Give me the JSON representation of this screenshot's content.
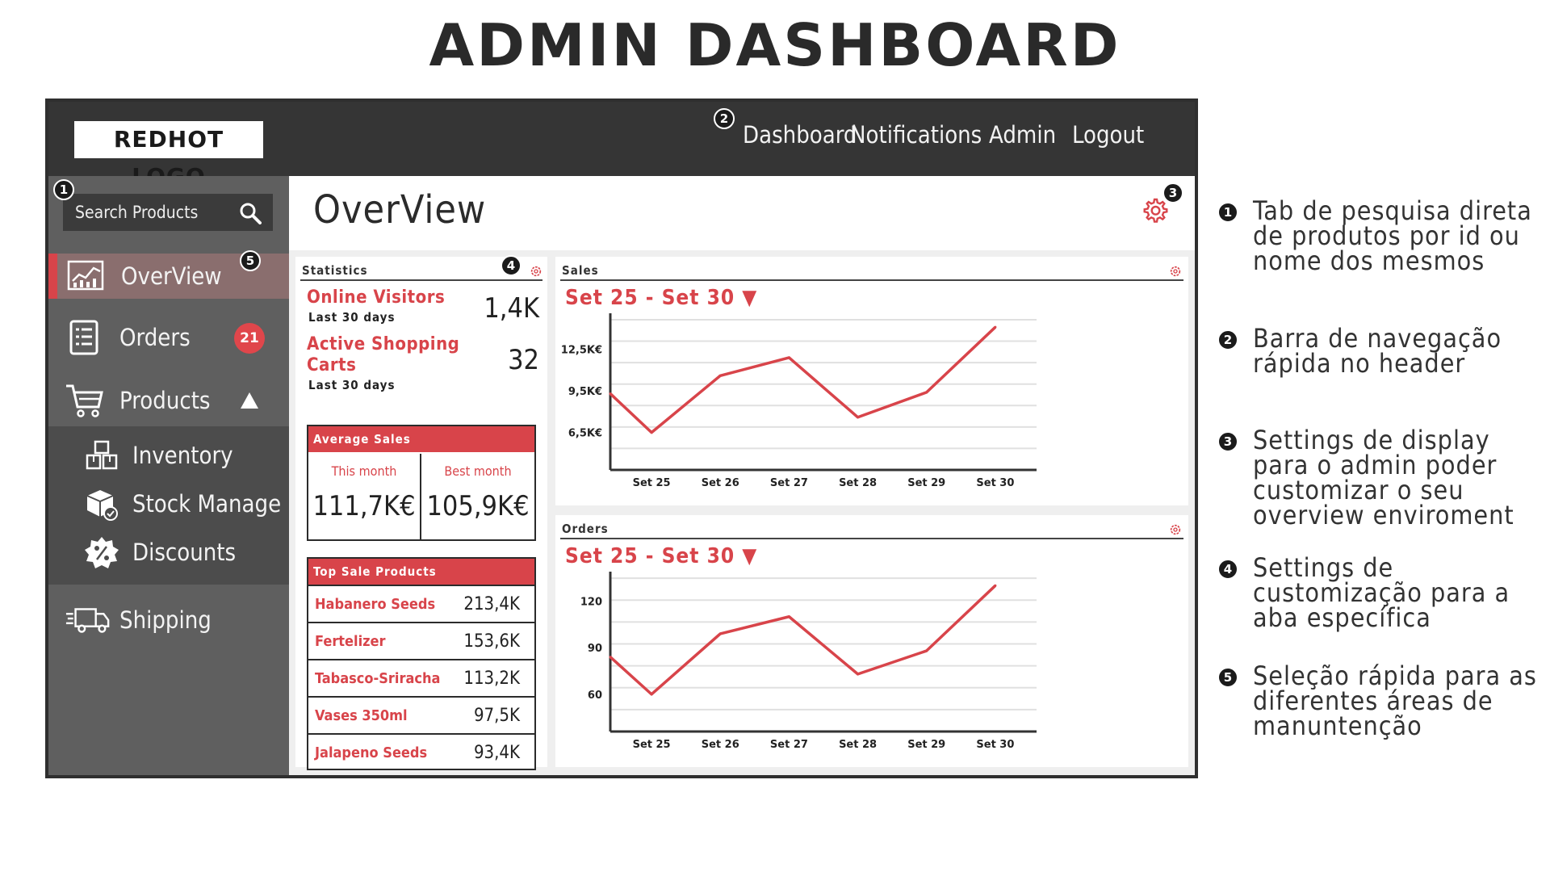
{
  "page": {
    "title": "ADMIN DASHBOARD"
  },
  "header": {
    "logo": "REDHOT LOGO",
    "nav": [
      "Dashboard",
      "Notifications",
      "Admin",
      "Logout"
    ]
  },
  "markers": [
    "1",
    "2",
    "3",
    "4",
    "5"
  ],
  "sidebar": {
    "search_placeholder": "Search Products",
    "items": [
      {
        "label": "OverView",
        "icon": "overview-icon"
      },
      {
        "label": "Orders",
        "icon": "orders-icon",
        "badge": "21"
      },
      {
        "label": "Products",
        "icon": "cart-icon"
      },
      {
        "label": "Shipping",
        "icon": "truck-icon"
      }
    ],
    "subitems": [
      {
        "label": "Inventory",
        "icon": "boxes-icon"
      },
      {
        "label": "Stock Manage",
        "icon": "stock-box-icon"
      },
      {
        "label": "Discounts",
        "icon": "discount-icon"
      }
    ]
  },
  "main": {
    "title": "OverView",
    "statistics": {
      "title": "Statistics",
      "items": [
        {
          "label": "Online Visitors",
          "sub": "Last 30 days",
          "value": "1,4K"
        },
        {
          "label": "Active Shopping Carts",
          "sub": "Last 30 days",
          "value": "32"
        }
      ],
      "avg_sales": {
        "title": "Average Sales",
        "cells": [
          {
            "label": "This month",
            "value": "111,7K€"
          },
          {
            "label": "Best month",
            "value": "105,9K€"
          }
        ]
      },
      "top_products": {
        "title": "Top Sale Products",
        "rows": [
          {
            "name": "Habanero Seeds",
            "value": "213,4K"
          },
          {
            "name": "Fertelizer",
            "value": "153,6K"
          },
          {
            "name": "Tabasco-Sriracha",
            "value": "113,2K"
          },
          {
            "name": "Vases 350ml",
            "value": "97,5K"
          },
          {
            "name": "Jalapeno Seeds",
            "value": "93,4K"
          }
        ]
      }
    },
    "sales": {
      "title": "Sales",
      "range": "Set 25 - Set 30 ▼"
    },
    "orders": {
      "title": "Orders",
      "range": "Set 25 - Set 30 ▼"
    }
  },
  "legend": [
    {
      "num": "1",
      "text": "Tab de pesquisa direta de produtos por id ou nome dos mesmos"
    },
    {
      "num": "2",
      "text": "Barra de navegação rápida no header"
    },
    {
      "num": "3",
      "text": "Settings de display para o admin poder customizar o seu overview enviroment"
    },
    {
      "num": "4",
      "text": "Settings de customização para a aba específica"
    },
    {
      "num": "5",
      "text": "Seleção rápida para as diferentes áreas de manuntenção"
    }
  ],
  "colors": {
    "accent": "#d8444a",
    "topbar": "#353535",
    "sidebar": "#5f5f5f"
  },
  "chart_data": [
    {
      "type": "line",
      "title": "Sales",
      "categories": [
        "Set 25",
        "Set 26",
        "Set 27",
        "Set 28",
        "Set 29",
        "Set 30"
      ],
      "x": [
        24.4,
        25,
        26,
        27,
        28,
        29,
        30
      ],
      "values": [
        9.3,
        6.5,
        10.6,
        11.9,
        7.6,
        9.4,
        14.1
      ],
      "ytick_values": [
        12.5,
        9.5,
        6.5
      ],
      "yticks": [
        "12,5K€",
        "9,5K€",
        "6,5K€"
      ],
      "ylim": [
        3.8,
        15.1
      ],
      "xlim": [
        24.4,
        30.6
      ],
      "grid": true
    },
    {
      "type": "line",
      "title": "Orders",
      "categories": [
        "Set 25",
        "Set 26",
        "Set 27",
        "Set 28",
        "Set 29",
        "Set 30"
      ],
      "x": [
        24.4,
        25,
        26,
        27,
        28,
        29,
        30
      ],
      "values": [
        84,
        60,
        99,
        110,
        73,
        88,
        130
      ],
      "ytick_values": [
        120,
        90,
        60
      ],
      "yticks": [
        "120",
        "90",
        "60"
      ],
      "ylim": [
        36,
        139
      ],
      "xlim": [
        24.4,
        30.6
      ],
      "grid": true
    }
  ]
}
